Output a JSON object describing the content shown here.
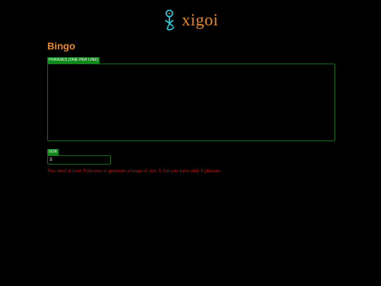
{
  "header": {
    "logo_text": "xigoi",
    "logo_icon": "xigoi-logo-icon",
    "logo_color": "#e8872a",
    "logo_icon_color": "#2ec5d8"
  },
  "main": {
    "title": "Bingo",
    "phrases": {
      "label": "Phrases (one per line)",
      "value": ""
    },
    "size": {
      "label": "Size",
      "value": "3"
    },
    "error": "You need at least 9 phrases to generate a bingo of size 3, but you have only 0 phrases."
  },
  "colors": {
    "background": "#000000",
    "accent": "#e8872a",
    "label_bg": "#0f8a1a",
    "border": "#1e6e24",
    "error": "#c41a1a"
  }
}
